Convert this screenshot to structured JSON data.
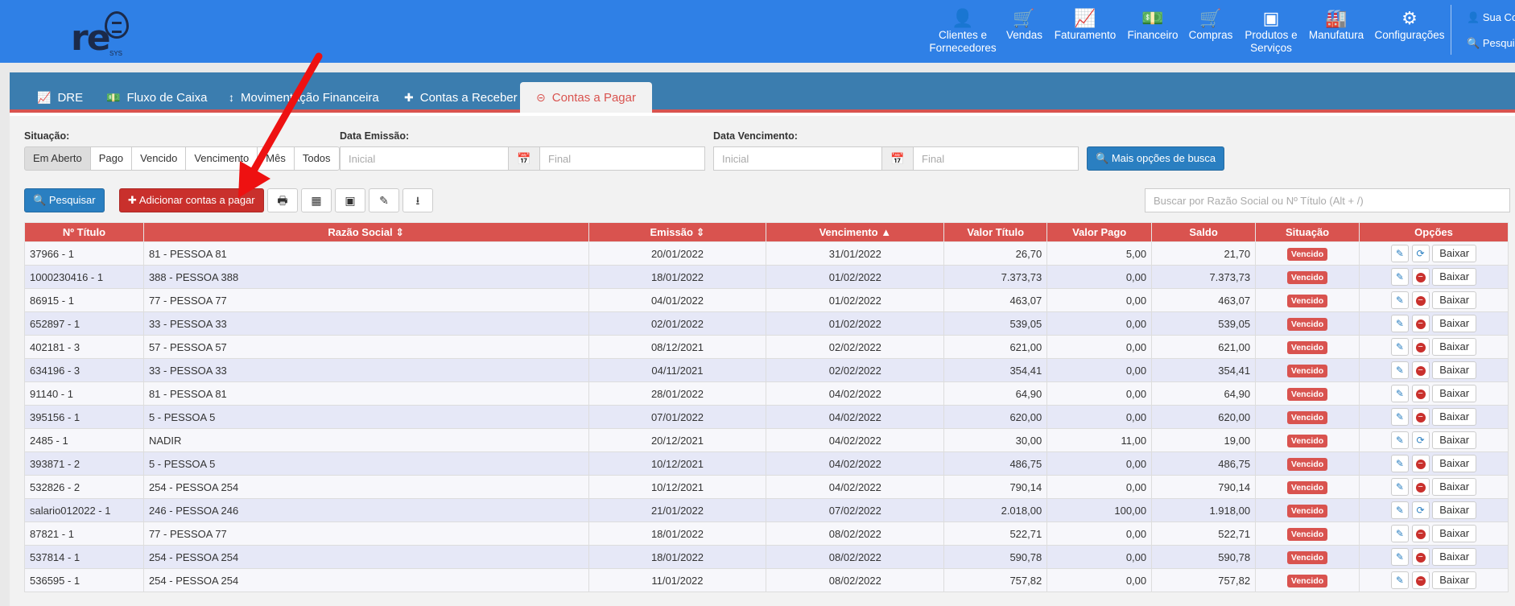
{
  "brand": {
    "logo_text": "re",
    "logo_sub": "SYS"
  },
  "nav": {
    "items": [
      {
        "label": "Clientes e Fornecedores",
        "icon": "user-icon"
      },
      {
        "label": "Vendas",
        "icon": "cart-icon"
      },
      {
        "label": "Faturamento",
        "icon": "chart-icon"
      },
      {
        "label": "Financeiro",
        "icon": "money-icon"
      },
      {
        "label": "Compras",
        "icon": "cart-icon"
      },
      {
        "label": "Produtos e Serviços",
        "icon": "cubes-icon"
      },
      {
        "label": "Manufatura",
        "icon": "industry-icon"
      },
      {
        "label": "Configurações",
        "icon": "gear-icon"
      }
    ],
    "user_label": "Sua Con",
    "search_label": "Pesquis"
  },
  "tabs": [
    {
      "label": "DRE",
      "icon": "line-chart-icon"
    },
    {
      "label": "Fluxo de Caixa",
      "icon": "money-icon"
    },
    {
      "label": "Movimentação Financeira",
      "icon": "arrows-v-icon"
    },
    {
      "label": "Contas a Receber",
      "icon": "plus-icon"
    },
    {
      "label": "Contas a Pagar",
      "icon": "minus-circle-icon",
      "active": true
    }
  ],
  "filters": {
    "situacao_label": "Situação:",
    "situacao_options": [
      "Em Aberto",
      "Pago",
      "Vencido",
      "Vencimento",
      "Mês",
      "Todos"
    ],
    "situacao_selected": "Em Aberto",
    "emissao_label": "Data Emissão:",
    "vencimento_label": "Data Vencimento:",
    "inicial_placeholder": "Inicial",
    "final_placeholder": "Final",
    "more_options": "Mais opções de busca"
  },
  "toolbar": {
    "search_button": "Pesquisar",
    "add_button": "Adicionar contas a pagar",
    "search_placeholder": "Buscar por Razão Social ou Nº Título (Alt + /)"
  },
  "table": {
    "headers": [
      "Nº Título",
      "Razão Social",
      "Emissão",
      "Vencimento",
      "Valor Título",
      "Valor Pago",
      "Saldo",
      "Situação",
      "Opções"
    ],
    "status_label": "Vencido",
    "baixar_label": "Baixar",
    "rows": [
      {
        "titulo": "37966 - 1",
        "razao": "81 - PESSOA 81",
        "emissao": "20/01/2022",
        "vencimento": "31/01/2022",
        "valor": "26,70",
        "pago": "5,00",
        "saldo": "21,70",
        "refresh": true
      },
      {
        "titulo": "1000230416 - 1",
        "razao": "388 - PESSOA 388",
        "emissao": "18/01/2022",
        "vencimento": "01/02/2022",
        "valor": "7.373,73",
        "pago": "0,00",
        "saldo": "7.373,73",
        "refresh": false
      },
      {
        "titulo": "86915 - 1",
        "razao": "77 - PESSOA 77",
        "emissao": "04/01/2022",
        "vencimento": "01/02/2022",
        "valor": "463,07",
        "pago": "0,00",
        "saldo": "463,07",
        "refresh": false
      },
      {
        "titulo": "652897 - 1",
        "razao": "33 - PESSOA 33",
        "emissao": "02/01/2022",
        "vencimento": "01/02/2022",
        "valor": "539,05",
        "pago": "0,00",
        "saldo": "539,05",
        "refresh": false
      },
      {
        "titulo": "402181 - 3",
        "razao": "57 - PESSOA 57",
        "emissao": "08/12/2021",
        "vencimento": "02/02/2022",
        "valor": "621,00",
        "pago": "0,00",
        "saldo": "621,00",
        "refresh": false
      },
      {
        "titulo": "634196 - 3",
        "razao": "33 - PESSOA 33",
        "emissao": "04/11/2021",
        "vencimento": "02/02/2022",
        "valor": "354,41",
        "pago": "0,00",
        "saldo": "354,41",
        "refresh": false
      },
      {
        "titulo": "91140 - 1",
        "razao": "81 - PESSOA 81",
        "emissao": "28/01/2022",
        "vencimento": "04/02/2022",
        "valor": "64,90",
        "pago": "0,00",
        "saldo": "64,90",
        "refresh": false
      },
      {
        "titulo": "395156 - 1",
        "razao": "5 - PESSOA 5",
        "emissao": "07/01/2022",
        "vencimento": "04/02/2022",
        "valor": "620,00",
        "pago": "0,00",
        "saldo": "620,00",
        "refresh": false
      },
      {
        "titulo": "2485 - 1",
        "razao": "NADIR",
        "emissao": "20/12/2021",
        "vencimento": "04/02/2022",
        "valor": "30,00",
        "pago": "11,00",
        "saldo": "19,00",
        "refresh": true
      },
      {
        "titulo": "393871 - 2",
        "razao": "5 - PESSOA 5",
        "emissao": "10/12/2021",
        "vencimento": "04/02/2022",
        "valor": "486,75",
        "pago": "0,00",
        "saldo": "486,75",
        "refresh": false
      },
      {
        "titulo": "532826 - 2",
        "razao": "254 - PESSOA 254",
        "emissao": "10/12/2021",
        "vencimento": "04/02/2022",
        "valor": "790,14",
        "pago": "0,00",
        "saldo": "790,14",
        "refresh": false
      },
      {
        "titulo": "salario012022 - 1",
        "razao": "246 - PESSOA 246",
        "emissao": "21/01/2022",
        "vencimento": "07/02/2022",
        "valor": "2.018,00",
        "pago": "100,00",
        "saldo": "1.918,00",
        "refresh": true
      },
      {
        "titulo": "87821 - 1",
        "razao": "77 - PESSOA 77",
        "emissao": "18/01/2022",
        "vencimento": "08/02/2022",
        "valor": "522,71",
        "pago": "0,00",
        "saldo": "522,71",
        "refresh": false
      },
      {
        "titulo": "537814 - 1",
        "razao": "254 - PESSOA 254",
        "emissao": "18/01/2022",
        "vencimento": "08/02/2022",
        "valor": "590,78",
        "pago": "0,00",
        "saldo": "590,78",
        "refresh": false
      },
      {
        "titulo": "536595 - 1",
        "razao": "254 - PESSOA 254",
        "emissao": "11/01/2022",
        "vencimento": "08/02/2022",
        "valor": "757,82",
        "pago": "0,00",
        "saldo": "757,82",
        "refresh": false
      }
    ]
  },
  "colors": {
    "topbar": "#2f80e6",
    "tabbar": "#3b7daf",
    "accent_red": "#d9534f",
    "button_blue": "#2a7fc1"
  }
}
